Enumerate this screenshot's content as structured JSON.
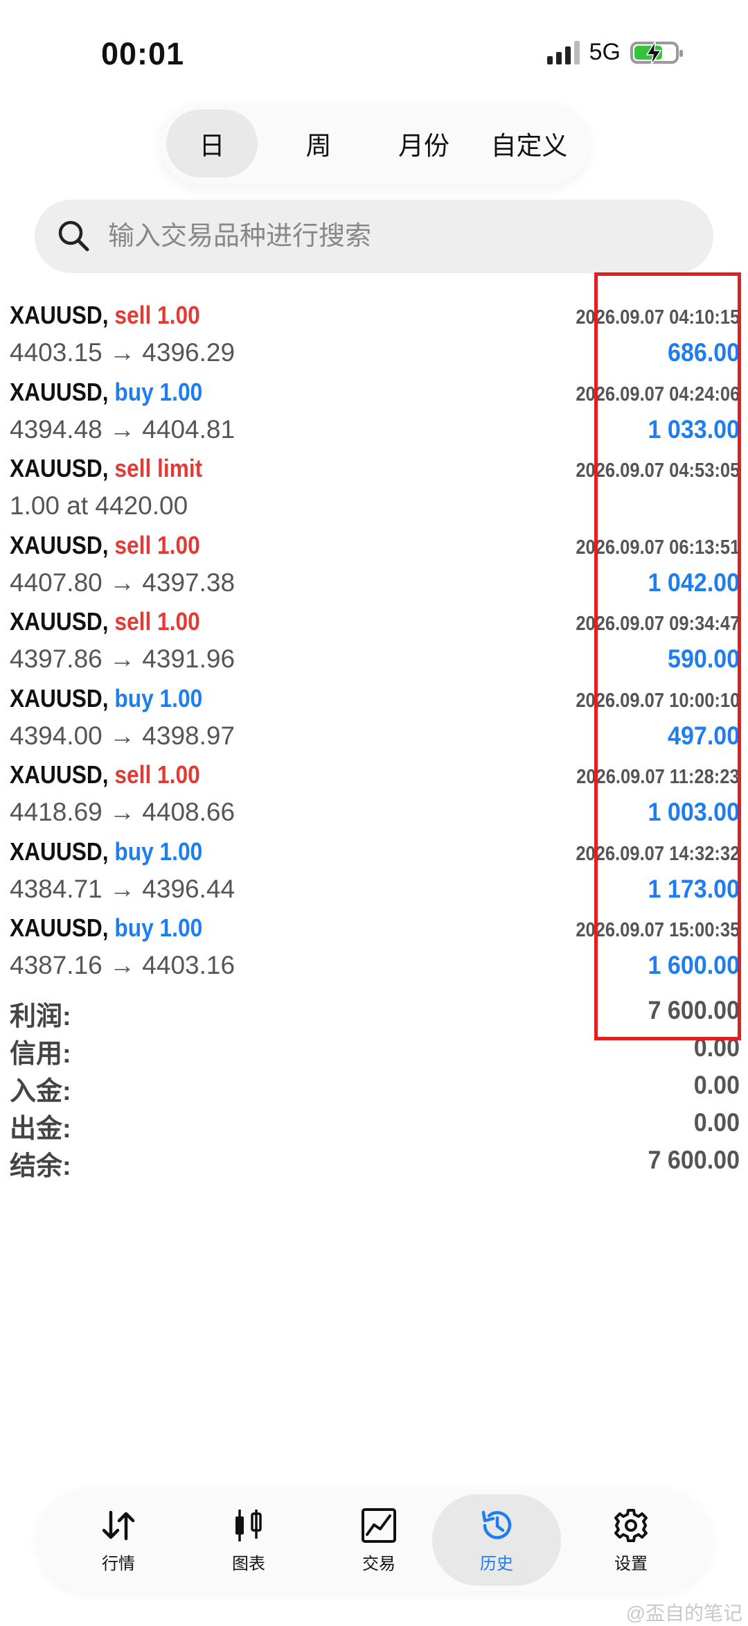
{
  "status_bar": {
    "time": "00:01",
    "network": "5G"
  },
  "period_tabs": [
    {
      "label": "日",
      "active": true
    },
    {
      "label": "周",
      "active": false
    },
    {
      "label": "月份",
      "active": false
    },
    {
      "label": "自定义",
      "active": false
    }
  ],
  "search": {
    "placeholder": "输入交易品种进行搜索"
  },
  "trades": [
    {
      "symbol": "XAUUSD,",
      "side": "sell 1.00",
      "side_type": "sell",
      "prices": "4403.15 → 4396.29",
      "time": "2026.09.07 04:10:15",
      "profit": "686.00"
    },
    {
      "symbol": "XAUUSD,",
      "side": "buy 1.00",
      "side_type": "buy",
      "prices": "4394.48 → 4404.81",
      "time": "2026.09.07 04:24:06",
      "profit": "1 033.00"
    },
    {
      "symbol": "XAUUSD,",
      "side": "sell limit",
      "side_type": "sell",
      "prices": "1.00 at 4420.00",
      "time": "2026.09.07 04:53:05",
      "profit": ""
    },
    {
      "symbol": "XAUUSD,",
      "side": "sell 1.00",
      "side_type": "sell",
      "prices": "4407.80 → 4397.38",
      "time": "2026.09.07 06:13:51",
      "profit": "1 042.00"
    },
    {
      "symbol": "XAUUSD,",
      "side": "sell 1.00",
      "side_type": "sell",
      "prices": "4397.86 → 4391.96",
      "time": "2026.09.07 09:34:47",
      "profit": "590.00"
    },
    {
      "symbol": "XAUUSD,",
      "side": "buy 1.00",
      "side_type": "buy",
      "prices": "4394.00 → 4398.97",
      "time": "2026.09.07 10:00:10",
      "profit": "497.00"
    },
    {
      "symbol": "XAUUSD,",
      "side": "sell 1.00",
      "side_type": "sell",
      "prices": "4418.69 → 4408.66",
      "time": "2026.09.07 11:28:23",
      "profit": "1 003.00"
    },
    {
      "symbol": "XAUUSD,",
      "side": "buy 1.00",
      "side_type": "buy",
      "prices": "4384.71 → 4396.44",
      "time": "2026.09.07 14:32:32",
      "profit": "1 173.00"
    },
    {
      "symbol": "XAUUSD,",
      "side": "buy 1.00",
      "side_type": "buy",
      "prices": "4387.16 → 4403.16",
      "time": "2026.09.07 15:00:35",
      "profit": "1 600.00"
    }
  ],
  "summary": [
    {
      "label": "利润:",
      "value": "7 600.00"
    },
    {
      "label": "信用:",
      "value": "0.00"
    },
    {
      "label": "入金:",
      "value": "0.00"
    },
    {
      "label": "出金:",
      "value": "0.00"
    },
    {
      "label": "结余:",
      "value": "7 600.00"
    }
  ],
  "bottom_nav": [
    {
      "label": "行情",
      "icon": "quotes-icon",
      "active": false
    },
    {
      "label": "图表",
      "icon": "chart-icon",
      "active": false
    },
    {
      "label": "交易",
      "icon": "trade-icon",
      "active": false
    },
    {
      "label": "历史",
      "icon": "history-icon",
      "active": true
    },
    {
      "label": "设置",
      "icon": "gear-icon",
      "active": false
    }
  ],
  "watermark": "@盃自的笔记",
  "colors": {
    "sell": "#e53935",
    "buy": "#1e7ef0",
    "highlight": "#e41e1e"
  }
}
